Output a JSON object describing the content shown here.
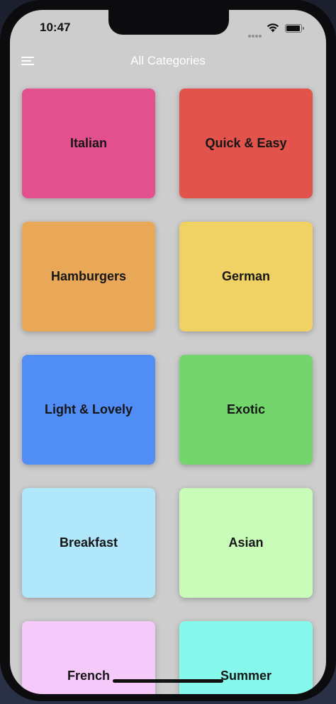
{
  "status_bar": {
    "time": "10:47"
  },
  "nav": {
    "title": "All Categories",
    "menu_icon": "hamburger-menu-icon"
  },
  "categories": [
    {
      "label": "Italian",
      "color": "#e2508e"
    },
    {
      "label": "Quick & Easy",
      "color": "#e2534c"
    },
    {
      "label": "Hamburgers",
      "color": "#e9a758"
    },
    {
      "label": "German",
      "color": "#efd263"
    },
    {
      "label": "Light & Lovely",
      "color": "#508df5"
    },
    {
      "label": "Exotic",
      "color": "#73d56b"
    },
    {
      "label": "Breakfast",
      "color": "#b0e7fb"
    },
    {
      "label": "Asian",
      "color": "#c9fbb9"
    },
    {
      "label": "French",
      "color": "#f5c9f9"
    },
    {
      "label": "Summer",
      "color": "#87f9ec"
    }
  ],
  "colors": {
    "screen_background": "#cdcdcd",
    "nav_text": "#ffffff"
  }
}
